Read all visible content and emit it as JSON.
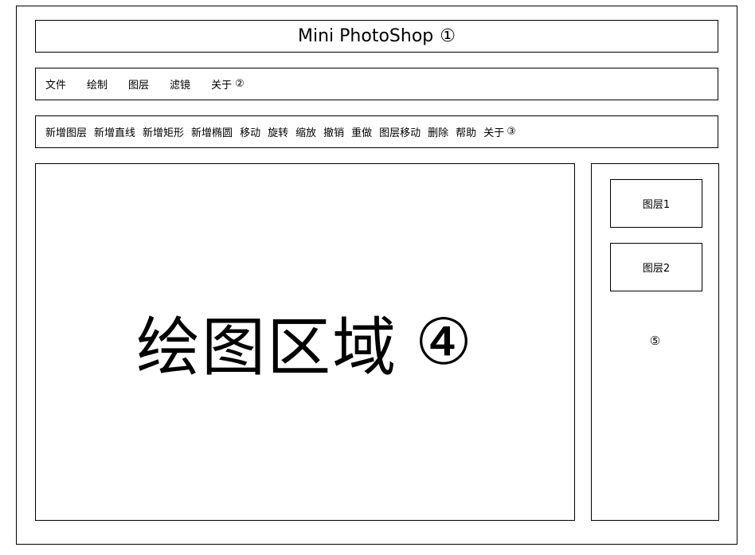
{
  "window": {
    "title": "Mini PhotoShop",
    "title_num": "①"
  },
  "menu": {
    "items": [
      "文件",
      "绘制",
      "图层",
      "滤镜",
      "关于"
    ],
    "num": "②"
  },
  "toolbar": {
    "items": [
      "新增图层",
      "新增直线",
      "新增矩形",
      "新增椭圆",
      "移动",
      "旋转",
      "缩放",
      "撤销",
      "重做",
      "图层移动",
      "删除",
      "帮助",
      "关于"
    ],
    "num": "③"
  },
  "canvas": {
    "label": "绘图区域",
    "num": "④"
  },
  "layers": {
    "items": [
      "图层1",
      "图层2"
    ],
    "num": "⑤"
  }
}
